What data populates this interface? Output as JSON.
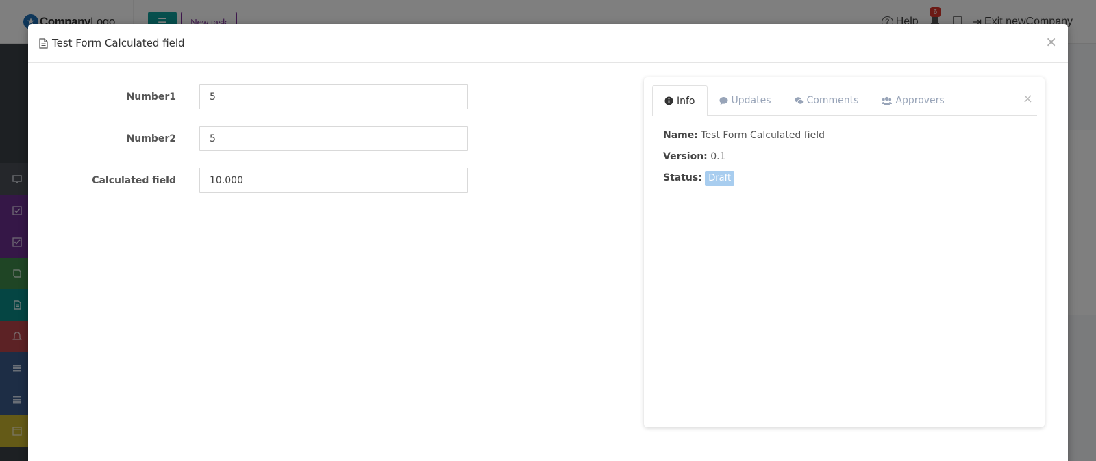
{
  "background": {
    "logo": {
      "bold": "Company",
      "light": "Logo"
    },
    "new_task_label": "New task",
    "help_label": "Help",
    "notification_count": "6",
    "exit_label": "Exit newCompany"
  },
  "modal": {
    "title": "Test Form Calculated field",
    "close_symbol": "×",
    "fields": [
      {
        "label": "Number1",
        "value": "5"
      },
      {
        "label": "Number2",
        "value": "5"
      },
      {
        "label": "Calculated field",
        "value": "10.000"
      }
    ]
  },
  "panel": {
    "tabs": [
      {
        "label": "Info",
        "icon": "info-circle-icon"
      },
      {
        "label": "Updates",
        "icon": "speech-bubble-icon"
      },
      {
        "label": "Comments",
        "icon": "comments-icon"
      },
      {
        "label": "Approvers",
        "icon": "users-icon"
      }
    ],
    "close_symbol": "×",
    "info": {
      "name_label": "Name:",
      "name_value": "Test Form Calculated field",
      "version_label": "Version:",
      "version_value": "0.1",
      "status_label": "Status:",
      "status_value": "Draft"
    }
  },
  "colors": {
    "accent_teal": "#0f9e9a",
    "accent_purple": "#7b2c99",
    "status_draft": "#a8cdef",
    "tab_inactive": "#98a4b8"
  }
}
